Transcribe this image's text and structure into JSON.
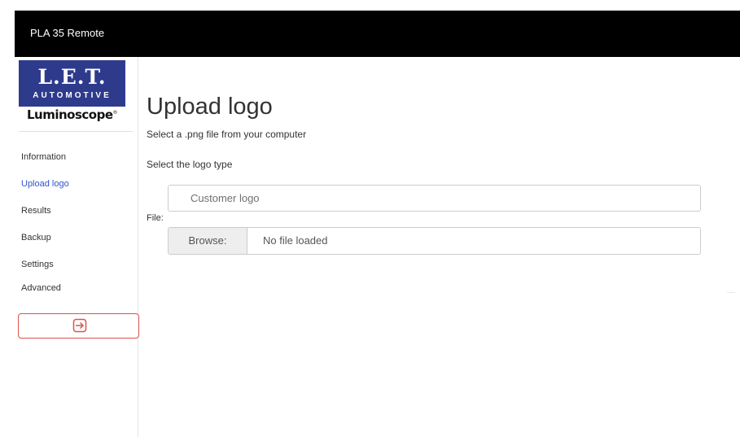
{
  "app": {
    "title": "PLA 35 Remote"
  },
  "brand": {
    "logo_main": "L.E.T.",
    "logo_sub": "AUTOMOTIVE",
    "logo_product": "Luminoscope",
    "logo_mark": "®",
    "colors": {
      "logo_bg": "#2e3b8c",
      "accent": "#2f55c8",
      "logout_border": "#d9534f"
    }
  },
  "sidebar": {
    "items": [
      {
        "label": "Information",
        "active": false
      },
      {
        "label": "Upload logo",
        "active": true
      },
      {
        "label": "Results",
        "active": false
      },
      {
        "label": "Backup",
        "active": false
      },
      {
        "label": "Settings",
        "active": false
      },
      {
        "label": "Advanced",
        "active": false
      }
    ],
    "logout_icon": "logout-arrow-icon"
  },
  "main": {
    "title": "Upload logo",
    "subtitle": "Select a .png file from your computer",
    "logo_type_label": "Select the logo type",
    "logo_type_selected": "Customer logo",
    "file_label": "File:",
    "browse_label": "Browse:",
    "file_status": "No file loaded"
  }
}
